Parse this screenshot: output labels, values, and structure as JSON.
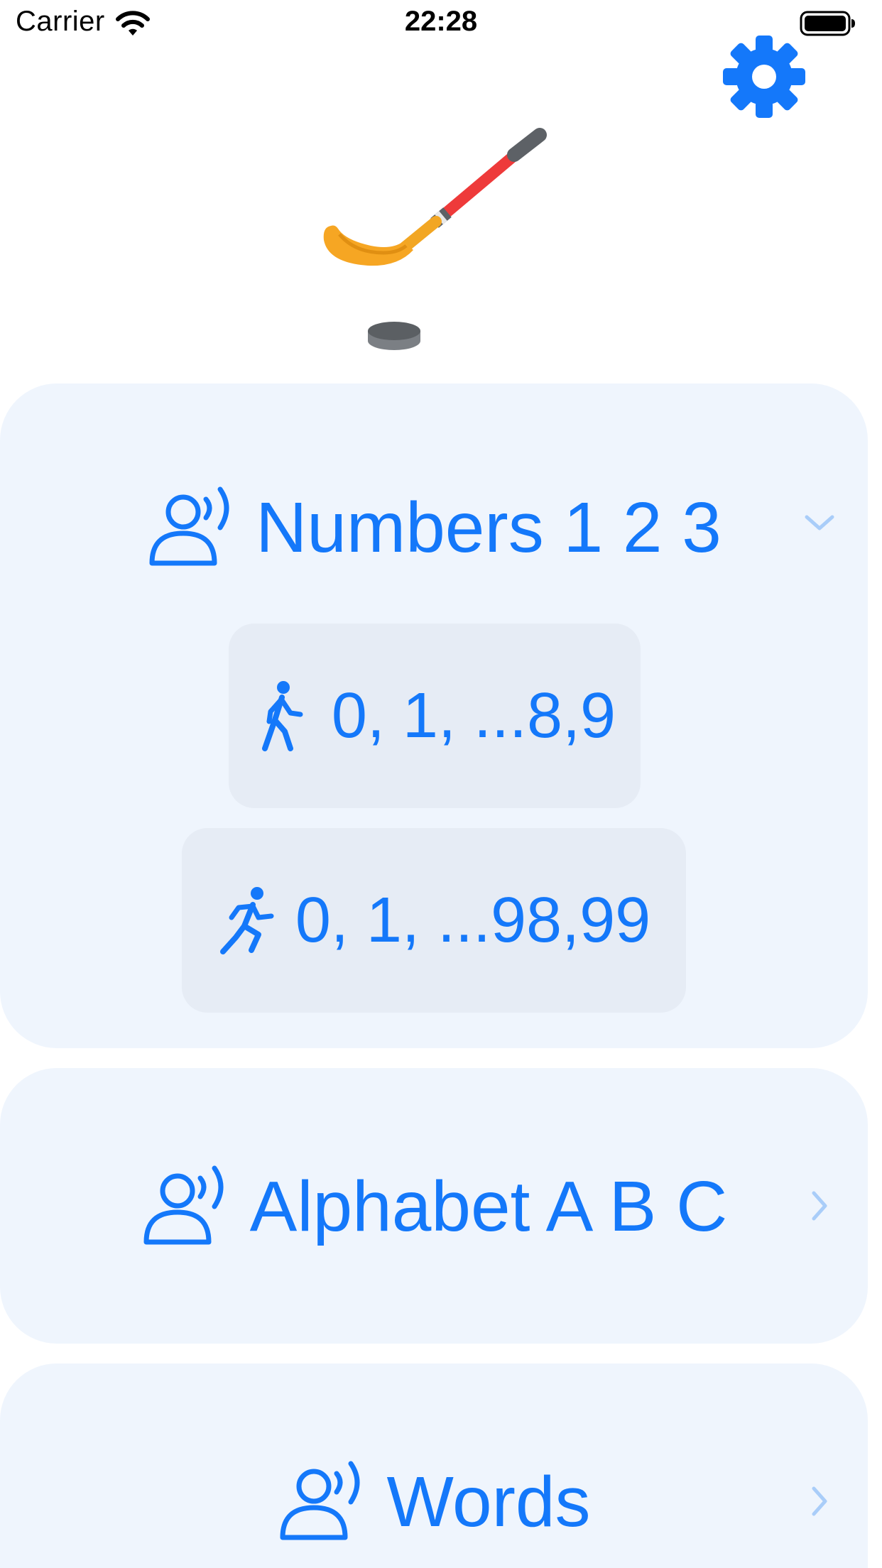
{
  "status_bar": {
    "carrier": "Carrier",
    "time": "22:28",
    "wifi_icon": "wifi-icon",
    "battery_icon": "battery-full-icon"
  },
  "header": {
    "settings_icon": "gear-icon",
    "hero_icons": [
      "hockey-stick-icon",
      "hockey-puck-icon"
    ]
  },
  "colors": {
    "accent": "#1478fa",
    "card_background": "#eff5fd",
    "sub_button_background": "#e6ecf5",
    "chevron": "#a9cdf9"
  },
  "sections": [
    {
      "title": "Numbers 1 2 3",
      "icon": "person-speaking-icon",
      "expanded": true,
      "chevron": "chevron-down-icon",
      "items": [
        {
          "label": "0, 1, ...8,9",
          "icon": "walking-figure-icon"
        },
        {
          "label": "0, 1, ...98,99",
          "icon": "running-figure-icon"
        }
      ]
    },
    {
      "title": "Alphabet A B C",
      "icon": "person-speaking-icon",
      "expanded": false,
      "chevron": "chevron-right-icon"
    },
    {
      "title": "Words",
      "icon": "person-speaking-icon",
      "expanded": false,
      "chevron": "chevron-right-icon"
    }
  ]
}
